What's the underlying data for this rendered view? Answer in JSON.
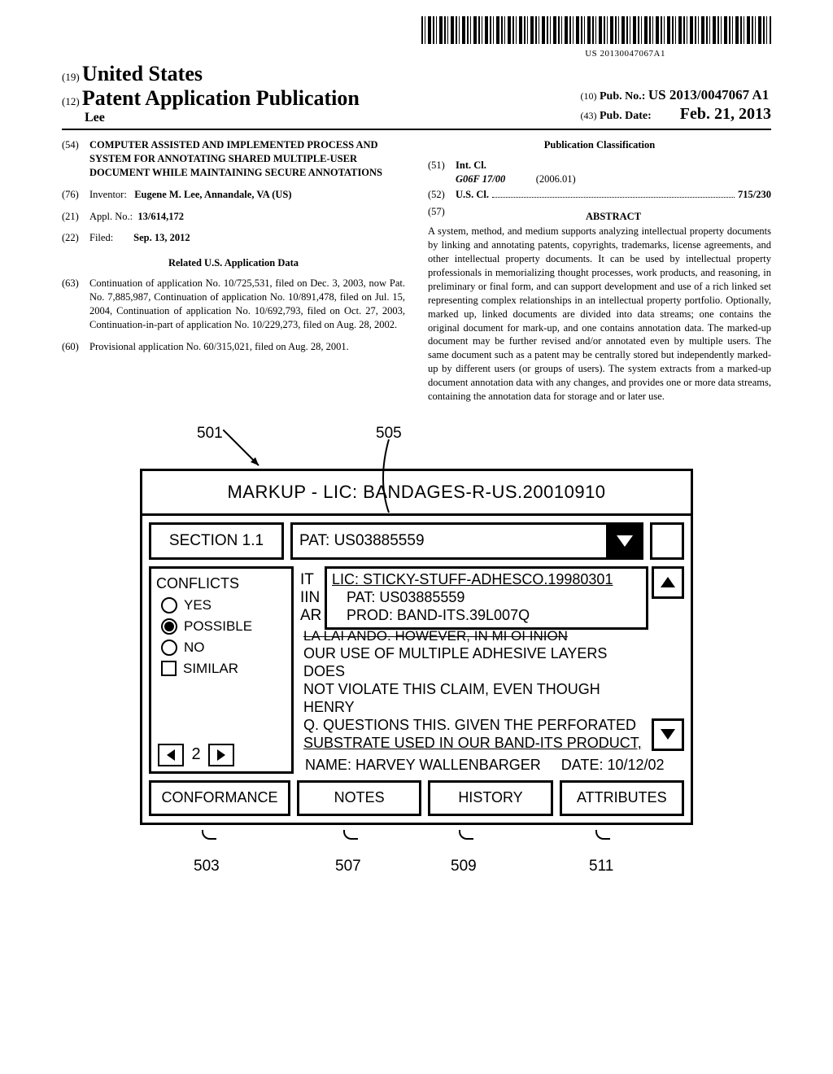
{
  "barcode_caption": "US 20130047067A1",
  "header": {
    "inid19": "(19)",
    "country": "United States",
    "inid12": "(12)",
    "doc_type": "Patent Application Publication",
    "author": "Lee",
    "inid10": "(10)",
    "pubno_label": "Pub. No.:",
    "pubno_value": "US 2013/0047067 A1",
    "inid43": "(43)",
    "pubdate_label": "Pub. Date:",
    "pubdate_value": "Feb. 21, 2013"
  },
  "left": {
    "inid54": "(54)",
    "title": "COMPUTER ASSISTED AND IMPLEMENTED PROCESS AND SYSTEM FOR ANNOTATING SHARED MULTIPLE-USER DOCUMENT WHILE MAINTAINING SECURE ANNOTATIONS",
    "inid76": "(76)",
    "inventor_label": "Inventor:",
    "inventor_value": "Eugene M. Lee, Annandale, VA (US)",
    "inid21": "(21)",
    "appl_label": "Appl. No.:",
    "appl_value": "13/614,172",
    "inid22": "(22)",
    "filed_label": "Filed:",
    "filed_value": "Sep. 13, 2012",
    "related_hd": "Related U.S. Application Data",
    "inid63": "(63)",
    "related63": "Continuation of application No. 10/725,531, filed on Dec. 3, 2003, now Pat. No. 7,885,987, Continuation of application No. 10/891,478, filed on Jul. 15, 2004, Continuation of application No. 10/692,793, filed on Oct. 27, 2003, Continuation-in-part of application No. 10/229,273, filed on Aug. 28, 2002.",
    "inid60": "(60)",
    "related60": "Provisional application No. 60/315,021, filed on Aug. 28, 2001."
  },
  "right": {
    "class_hd": "Publication Classification",
    "inid51": "(51)",
    "intcl_label": "Int. Cl.",
    "intcl_code": "G06F 17/00",
    "intcl_date": "(2006.01)",
    "inid52": "(52)",
    "uscl_label": "U.S. Cl.",
    "uscl_value": "715/230",
    "inid57": "(57)",
    "abstract_hd": "ABSTRACT",
    "abstract": "A system, method, and medium supports analyzing intellectual property documents by linking and annotating patents, copyrights, trademarks, license agreements, and other intellectual property documents. It can be used by intellectual property professionals in memorializing thought processes, work products, and reasoning, in preliminary or final form, and can support development and use of a rich linked set representing complex relationships in an intellectual property portfolio. Optionally, marked up, linked documents are divided into data streams; one contains the original document for mark-up, and one contains annotation data. The marked-up document may be further revised and/or annotated even by multiple users. The same document such as a patent may be centrally stored but independently marked-up by different users (or groups of users). The system extracts from a marked-up document annotation data with any changes, and provides one or more data streams, containing the annotation data for storage and or later use."
  },
  "figure": {
    "ref501": "501",
    "ref505": "505",
    "ref503": "503",
    "ref507": "507",
    "ref509": "509",
    "ref511": "511",
    "title": "MARKUP - LIC: BANDAGES-R-US.20010910",
    "section": "SECTION 1.1",
    "pat_selected": "PAT: US03885559",
    "dropdown": {
      "row1": "LIC: STICKY-STUFF-ADHESCO.19980301",
      "row2": "PAT: US03885559",
      "row3": "PROD: BAND-ITS.39L007Q"
    },
    "behind": {
      "l1": "IT",
      "l2": "IIN",
      "l3": "AR"
    },
    "overlap": "LA LAI ANDO. HOWEVER, IN MI OI INION",
    "opinion_l1": "OUR USE OF MULTIPLE ADHESIVE LAYERS DOES",
    "opinion_l2": "NOT VIOLATE THIS CLAIM, EVEN THOUGH HENRY",
    "opinion_l3": "Q. QUESTIONS THIS. GIVEN THE PERFORATED",
    "opinion_l4": "SUBSTRATE USED IN OUR BAND-ITS PRODUCT,",
    "conflicts_hd": "CONFLICTS",
    "opt_yes": "YES",
    "opt_possible": "POSSIBLE",
    "opt_no": "NO",
    "opt_similar": "SIMILAR",
    "step_value": "2",
    "name_label": "NAME:",
    "name_value": "HARVEY WALLENBARGER",
    "date_label": "DATE:",
    "date_value": "10/12/02",
    "tab_conformance": "CONFORMANCE",
    "tab_notes": "NOTES",
    "tab_history": "HISTORY",
    "tab_attributes": "ATTRIBUTES"
  }
}
